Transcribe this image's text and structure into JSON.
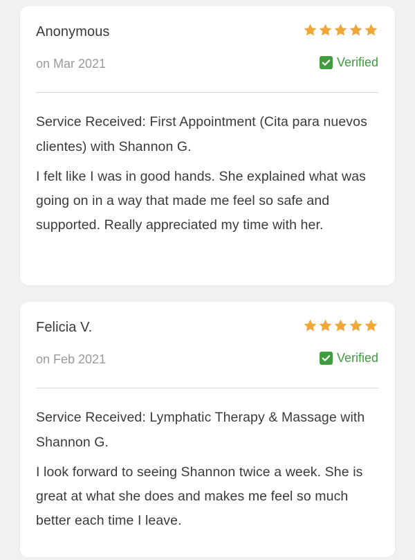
{
  "reviews": [
    {
      "name": "Anonymous",
      "date": "on Mar 2021",
      "verified_label": "Verified",
      "rating": 5,
      "service": "Service Received: First Appointment (Cita para nuevos clientes) with Shannon G.",
      "text": "I felt like I was in good hands. She explained what was going on in a way that made me feel so safe and supported. Really appreciated my time with her."
    },
    {
      "name": "Felicia V.",
      "date": "on Feb 2021",
      "verified_label": "Verified",
      "rating": 5,
      "service": "Service Received: Lymphatic Therapy & Massage with Shannon G.",
      "text": "I look forward to seeing Shannon twice a week. She is great at what she does and makes me feel so much better each time I leave."
    }
  ],
  "colors": {
    "star": "#f0a73a",
    "verified": "#3f9c3f",
    "background": "#f1f1f3",
    "card": "#ffffff"
  },
  "icons": {
    "rating": "star-icon",
    "verified": "check-icon"
  }
}
